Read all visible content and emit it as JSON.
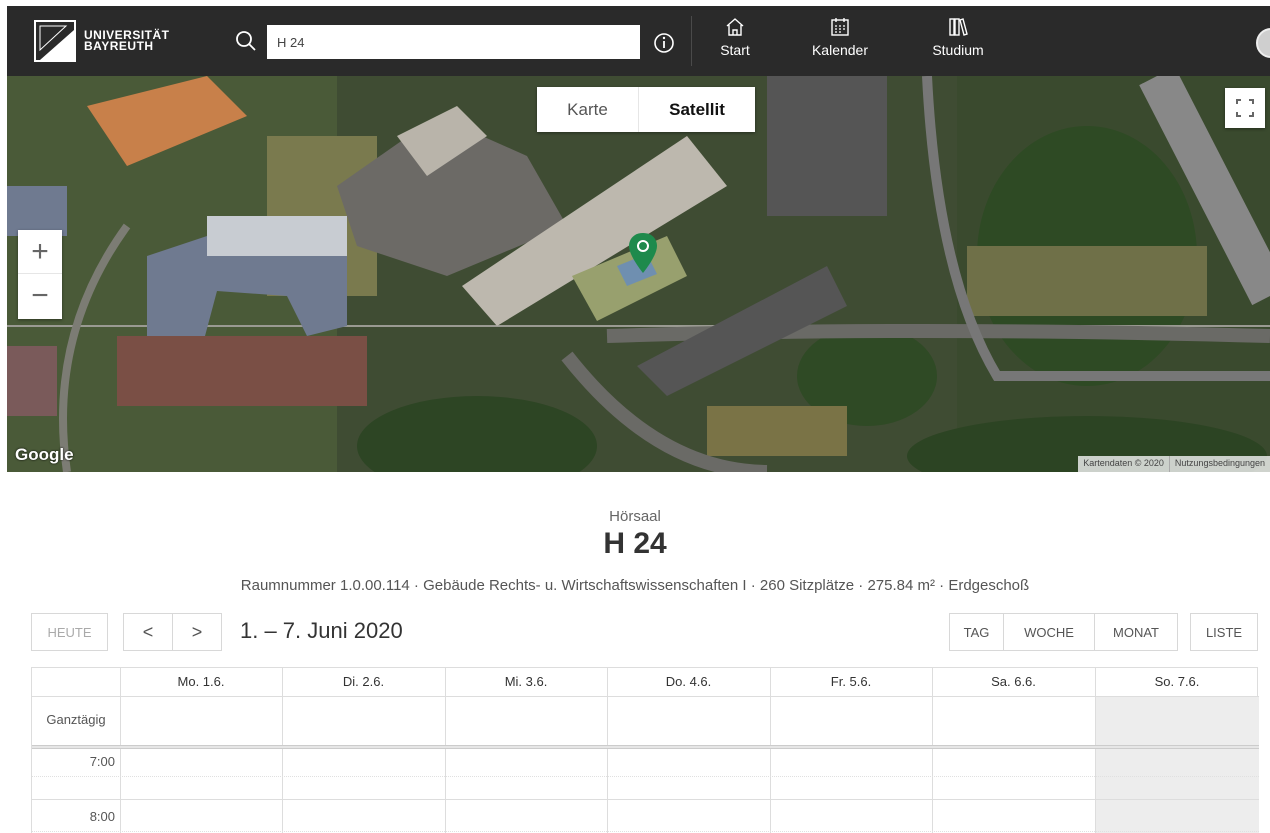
{
  "header": {
    "logo_line1": "UNIVERSITÄT",
    "logo_line2": "BAYREUTH",
    "search_value": "H 24",
    "nav": [
      {
        "label": "Start",
        "icon": "home-icon"
      },
      {
        "label": "Kalender",
        "icon": "calendar-icon"
      },
      {
        "label": "Studium",
        "icon": "books-icon"
      }
    ]
  },
  "map": {
    "map_types": [
      "Karte",
      "Satellit"
    ],
    "selected_map_type": "Satellit",
    "zoom_in": "+",
    "zoom_out": "−",
    "google_logo": "Google",
    "attribution": "Kartendaten © 2020",
    "terms": "Nutzungsbedingungen",
    "marker_color": "#1e8a4c"
  },
  "room": {
    "type": "Hörsaal",
    "name": "H 24",
    "details": "Raumnummer 1.0.00.114 · Gebäude Rechts- u. Wirtschaftswissenschaften I · 260 Sitzplätze · 275.84 m² · Erdgeschoß"
  },
  "calendar": {
    "today_label": "HEUTE",
    "prev_label": "<",
    "next_label": ">",
    "range_title": "1. – 7. Juni 2020",
    "views": [
      "TAG",
      "WOCHE",
      "MONAT"
    ],
    "list_label": "LISTE",
    "days": [
      "Mo. 1.6.",
      "Di. 2.6.",
      "Mi. 3.6.",
      "Do. 4.6.",
      "Fr. 5.6.",
      "Sa. 6.6.",
      "So. 7.6."
    ],
    "all_day_label": "Ganztägig",
    "times": [
      "7:00",
      "8:00"
    ]
  }
}
